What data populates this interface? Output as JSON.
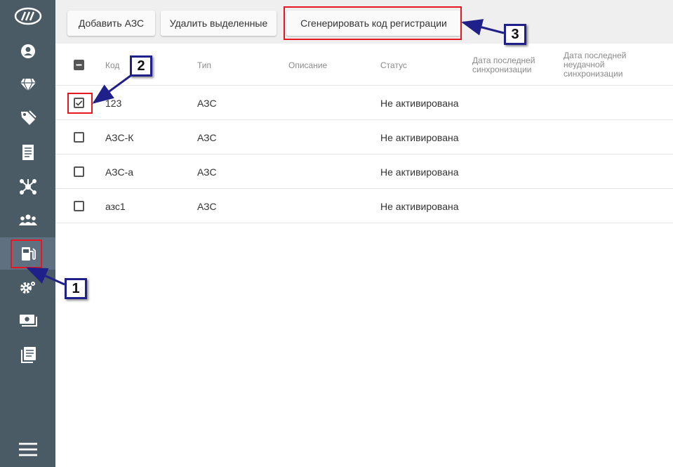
{
  "sidebar": {
    "items": [
      {
        "name": "logo-icon"
      },
      {
        "name": "user-icon"
      },
      {
        "name": "diamond-icon"
      },
      {
        "name": "tag-icon"
      },
      {
        "name": "receipt-icon"
      },
      {
        "name": "network-icon"
      },
      {
        "name": "users-icon"
      },
      {
        "name": "fuel-station-icon"
      },
      {
        "name": "settings-icon"
      },
      {
        "name": "cash-icon"
      },
      {
        "name": "journal-icon"
      },
      {
        "name": "menu-icon"
      }
    ]
  },
  "toolbar": {
    "add_label": "Добавить АЗС",
    "delete_label": "Удалить выделенные",
    "generate_label": "Сгенерировать код регистрации"
  },
  "table": {
    "columns": [
      "Код",
      "Тип",
      "Описание",
      "Статус",
      "Дата последней синхронизации",
      "Дата последней неудачной синхронизации"
    ],
    "rows": [
      {
        "code": "123",
        "type": "АЗС",
        "description": "",
        "status": "Не активирована",
        "checked": true
      },
      {
        "code": "АЗС-К",
        "type": "АЗС",
        "description": "",
        "status": "Не активирована",
        "checked": false
      },
      {
        "code": "АЗС-а",
        "type": "АЗС",
        "description": "",
        "status": "Не активирована",
        "checked": false
      },
      {
        "code": "азс1",
        "type": "АЗС",
        "description": "",
        "status": "Не активирована",
        "checked": false
      }
    ]
  },
  "annotations": {
    "badge1": "1",
    "badge2": "2",
    "badge3": "3"
  },
  "colors": {
    "sidebar": "#4a5b66",
    "highlight": "#e8161e",
    "annotation": "#20208a"
  }
}
